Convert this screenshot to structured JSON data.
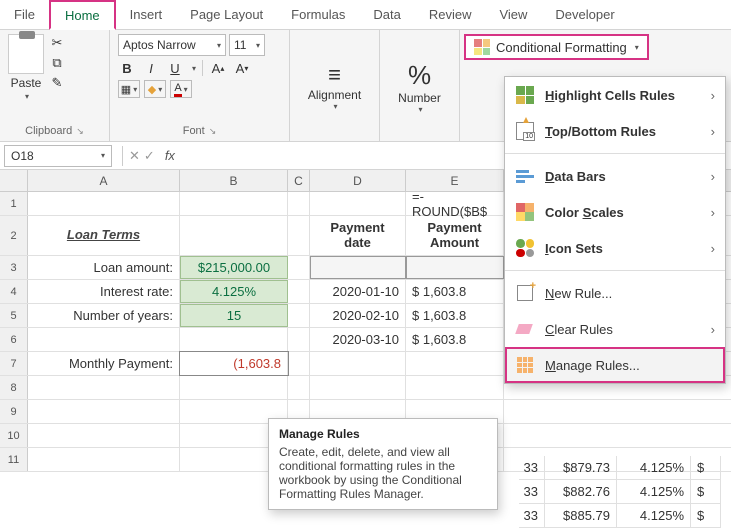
{
  "ribbon_tabs": [
    "File",
    "Home",
    "Insert",
    "Page Layout",
    "Formulas",
    "Data",
    "Review",
    "View",
    "Developer"
  ],
  "active_tab": "Home",
  "ribbon": {
    "clipboard": {
      "paste": "Paste",
      "label": "Clipboard"
    },
    "font": {
      "name": "Aptos Narrow",
      "size": "11",
      "bold": "B",
      "italic": "I",
      "underline": "U",
      "label": "Font"
    },
    "alignment": {
      "label": "Alignment"
    },
    "number": {
      "label": "Number"
    },
    "cf_button": "Conditional Formatting"
  },
  "name_box": "O18",
  "formula_bar": "",
  "columns": [
    "A",
    "B",
    "C",
    "D",
    "E"
  ],
  "rows": {
    "r1_e": "=-ROUND($B$",
    "r2": {
      "a": "Loan Terms",
      "d": "Payment date",
      "e": "Payment Amount"
    },
    "r3": {
      "a": "Loan amount:",
      "b": "$215,000.00"
    },
    "r4": {
      "a": "Interest rate:",
      "b": "4.125%",
      "d": "2020-01-10",
      "e": "$   1,603.8"
    },
    "r5": {
      "a": "Number of years:",
      "b": "15",
      "d": "2020-02-10",
      "e": "$   1,603.8"
    },
    "r6": {
      "d": "2020-03-10",
      "e": "$   1,603.8"
    },
    "r7": {
      "a": "Monthly Payment:",
      "b": "(1,603.8"
    },
    "r9": {
      "f_tail": "33",
      "g": "$879.73",
      "h": "4.125%",
      "i": "$"
    },
    "r10": {
      "f_tail": "33",
      "g": "$882.76",
      "h": "4.125%",
      "i": "$"
    },
    "r11": {
      "f_tail": "33",
      "g": "$885.79",
      "h": "4.125%",
      "i": "$"
    }
  },
  "cf_menu": {
    "highlight": "Highlight Cells Rules",
    "topbottom": "Top/Bottom Rules",
    "databars": "Data Bars",
    "colorscales": "Color Scales",
    "iconsets": "Icon Sets",
    "newrule": "New Rule...",
    "clearrules": "Clear Rules",
    "managerules": "Manage Rules..."
  },
  "tooltip": {
    "title": "Manage Rules",
    "body": "Create, edit, delete, and view all conditional formatting rules in the workbook by using the Conditional Formatting Rules Manager."
  }
}
